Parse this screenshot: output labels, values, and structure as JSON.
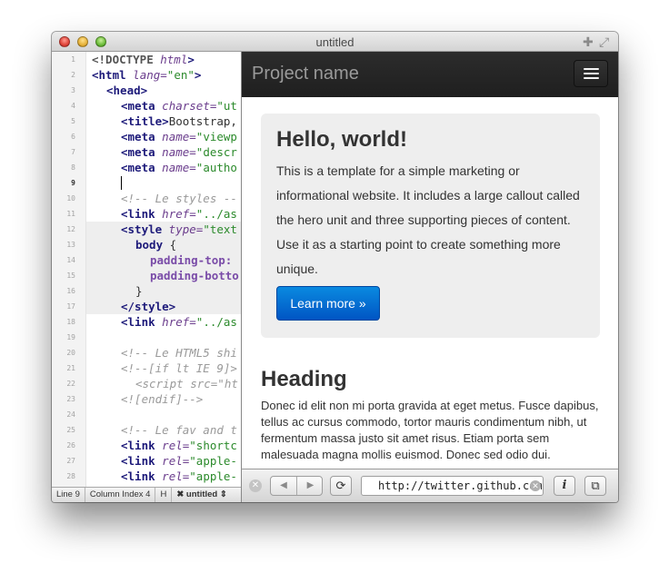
{
  "window": {
    "title": "untitled"
  },
  "editor": {
    "line_numbers": [
      "1",
      "2",
      "3",
      "4",
      "5",
      "6",
      "7",
      "8",
      "9",
      "10",
      "11",
      "12",
      "13",
      "14",
      "15",
      "16",
      "17",
      "18",
      "19",
      "20",
      "21",
      "22",
      "23",
      "24",
      "25",
      "26",
      "27",
      "28"
    ],
    "active_line": "9",
    "code": {
      "l1_a": "<!DOCTYPE",
      "l1_b": " html",
      "l1_c": ">",
      "l2_a": "<html",
      "l2_b": " lang=",
      "l2_c": "\"en\"",
      "l2_d": ">",
      "l3_a": "<head>",
      "l4_a": "<meta",
      "l4_b": " charset=",
      "l4_c": "\"ut",
      "l5_a": "<title>",
      "l5_b": "Bootstrap,",
      "l6_a": "<meta",
      "l6_b": " name=",
      "l6_c": "\"viewp",
      "l7_a": "<meta",
      "l7_b": " name=",
      "l7_c": "\"descr",
      "l8_a": "<meta",
      "l8_b": " name=",
      "l8_c": "\"autho",
      "l10": "<!-- Le styles --",
      "l11_a": "<link",
      "l11_b": " href=",
      "l11_c": "\"../as",
      "l12_a": "<style",
      "l12_b": " type=",
      "l12_c": "\"text",
      "l13_a": "body",
      "l13_b": " {",
      "l14": "padding-top:",
      "l15": "padding-botto",
      "l16": "}",
      "l17": "</style>",
      "l18_a": "<link",
      "l18_b": " href=",
      "l18_c": "\"../as",
      "l20": "<!-- Le HTML5 shi",
      "l21": "<!--[if lt IE 9]>",
      "l22": "<script src=\"ht",
      "l23": "<![endif]-->",
      "l25": "<!-- Le fav and t",
      "l26_a": "<link",
      "l26_b": " rel=",
      "l26_c": "\"shortc",
      "l27_a": "<link",
      "l27_b": " rel=",
      "l27_c": "\"apple-",
      "l28_a": "<link",
      "l28_b": " rel=",
      "l28_c": "\"apple-"
    }
  },
  "statusbar": {
    "line": "Line 9",
    "column": "Column Index 4",
    "mode": "H",
    "file": "untitled"
  },
  "preview": {
    "brand": "Project name",
    "hero": {
      "title": "Hello, world!",
      "text": "This is a template for a simple marketing or informational website. It includes a large callout called the hero unit and three supporting pieces of content. Use it as a starting point to create something more unique.",
      "button": "Learn more »"
    },
    "section": {
      "heading": "Heading",
      "text": "Donec id elit non mi porta gravida at eget metus. Fusce dapibus, tellus ac cursus commodo, tortor mauris condimentum nibh, ut fermentum massa justo sit amet risus. Etiam porta sem malesuada magna mollis euismod. Donec sed odio dui."
    }
  },
  "browser": {
    "url": "http://twitter.github.com/bootstrap/",
    "info_label": "i"
  },
  "colors": {
    "navbar": "#222222",
    "primary_button": "#0066cc",
    "hero_bg": "#eeeeee"
  }
}
